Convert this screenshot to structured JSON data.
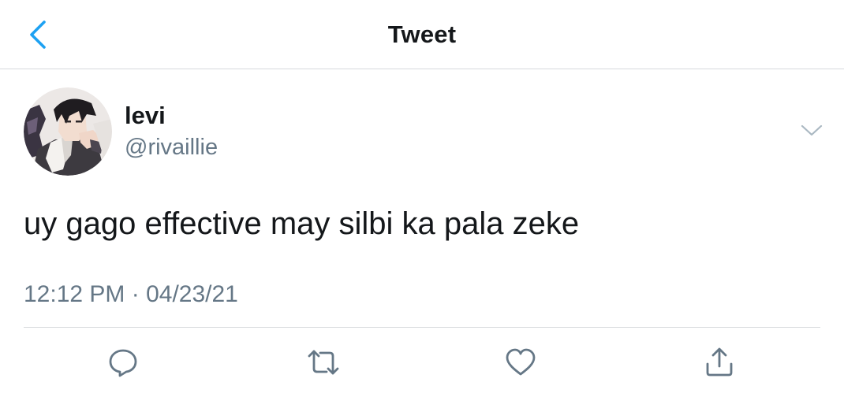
{
  "header": {
    "title": "Tweet",
    "back_icon": "chevron-left-icon"
  },
  "author": {
    "display_name": "levi",
    "handle": "@rivaillie",
    "avatar": "avatar-image"
  },
  "tweet": {
    "text": "uy gago effective may silbi ka pala zeke",
    "timestamp": "12:12 PM · 04/23/21"
  },
  "actions": [
    {
      "name": "reply",
      "icon": "reply-icon"
    },
    {
      "name": "retweet",
      "icon": "retweet-icon"
    },
    {
      "name": "like",
      "icon": "heart-icon"
    },
    {
      "name": "share",
      "icon": "share-icon"
    }
  ],
  "colors": {
    "accent": "#1da1f2",
    "text": "#14171a",
    "secondary": "#657786",
    "divider": "#d6d9dc",
    "icon": "#657786"
  }
}
